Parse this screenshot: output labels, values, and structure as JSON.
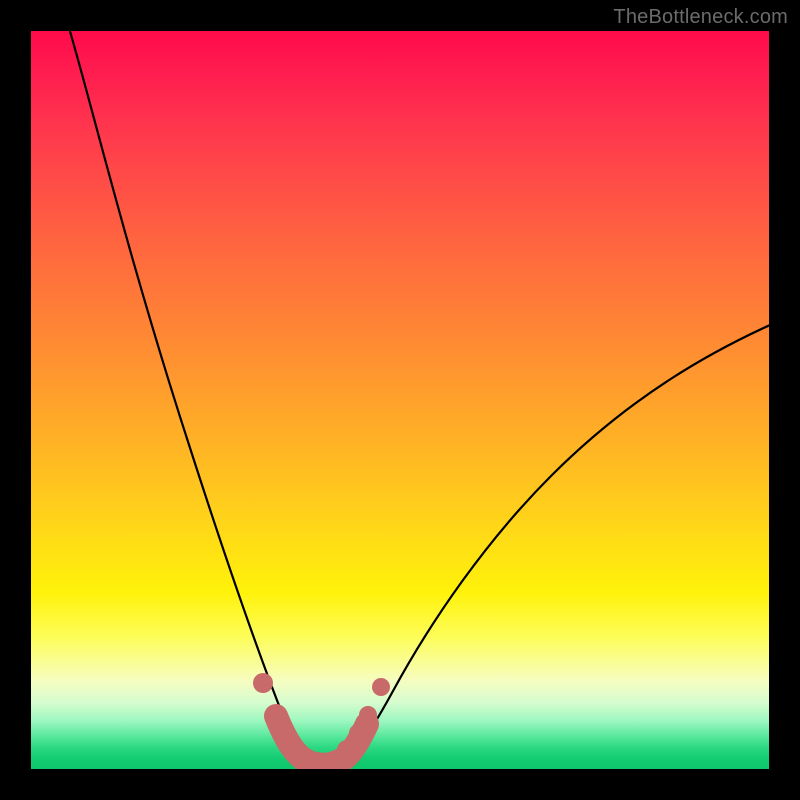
{
  "watermark": "TheBottleneck.com",
  "chart_data": {
    "type": "line",
    "title": "",
    "xlabel": "",
    "ylabel": "",
    "xlim": [
      0,
      100
    ],
    "ylim": [
      0,
      100
    ],
    "background_gradient": {
      "top": "#ff0a4a",
      "mid_upper": "#ff8a33",
      "mid_lower": "#fff20a",
      "bottom": "#0ec66c"
    },
    "series": [
      {
        "name": "left-curve",
        "stroke": "#000000",
        "x": [
          5,
          8,
          11,
          14,
          17,
          20,
          23,
          26,
          29,
          31,
          33,
          35,
          36.5
        ],
        "y": [
          100,
          91,
          81,
          71,
          61,
          51,
          41,
          31,
          21,
          13,
          7,
          3,
          0.3
        ]
      },
      {
        "name": "right-curve",
        "stroke": "#000000",
        "x": [
          41.5,
          43,
          45,
          48,
          52,
          57,
          63,
          70,
          78,
          87,
          96,
          100
        ],
        "y": [
          0.3,
          2,
          5,
          10,
          16,
          23,
          30,
          37,
          44,
          51,
          57,
          60
        ]
      },
      {
        "name": "trough-markers",
        "stroke": "#c86a6a",
        "marker_color": "#c86a6a",
        "marker_radius": 1.3,
        "x": [
          31,
          33,
          34.5,
          36,
          37.5,
          39,
          41,
          42.5,
          44,
          46.5
        ],
        "y": [
          12,
          7,
          3.5,
          1.5,
          0.8,
          0.8,
          1.5,
          3.5,
          6,
          11
        ]
      },
      {
        "name": "trough-thick-segment",
        "stroke": "#c86a6a",
        "stroke_width": 3.3,
        "x": [
          33,
          34.5,
          36,
          37.5,
          39,
          40.5,
          42,
          44
        ],
        "y": [
          7,
          3.5,
          1.5,
          0.8,
          0.8,
          1.2,
          3,
          6
        ]
      }
    ]
  }
}
